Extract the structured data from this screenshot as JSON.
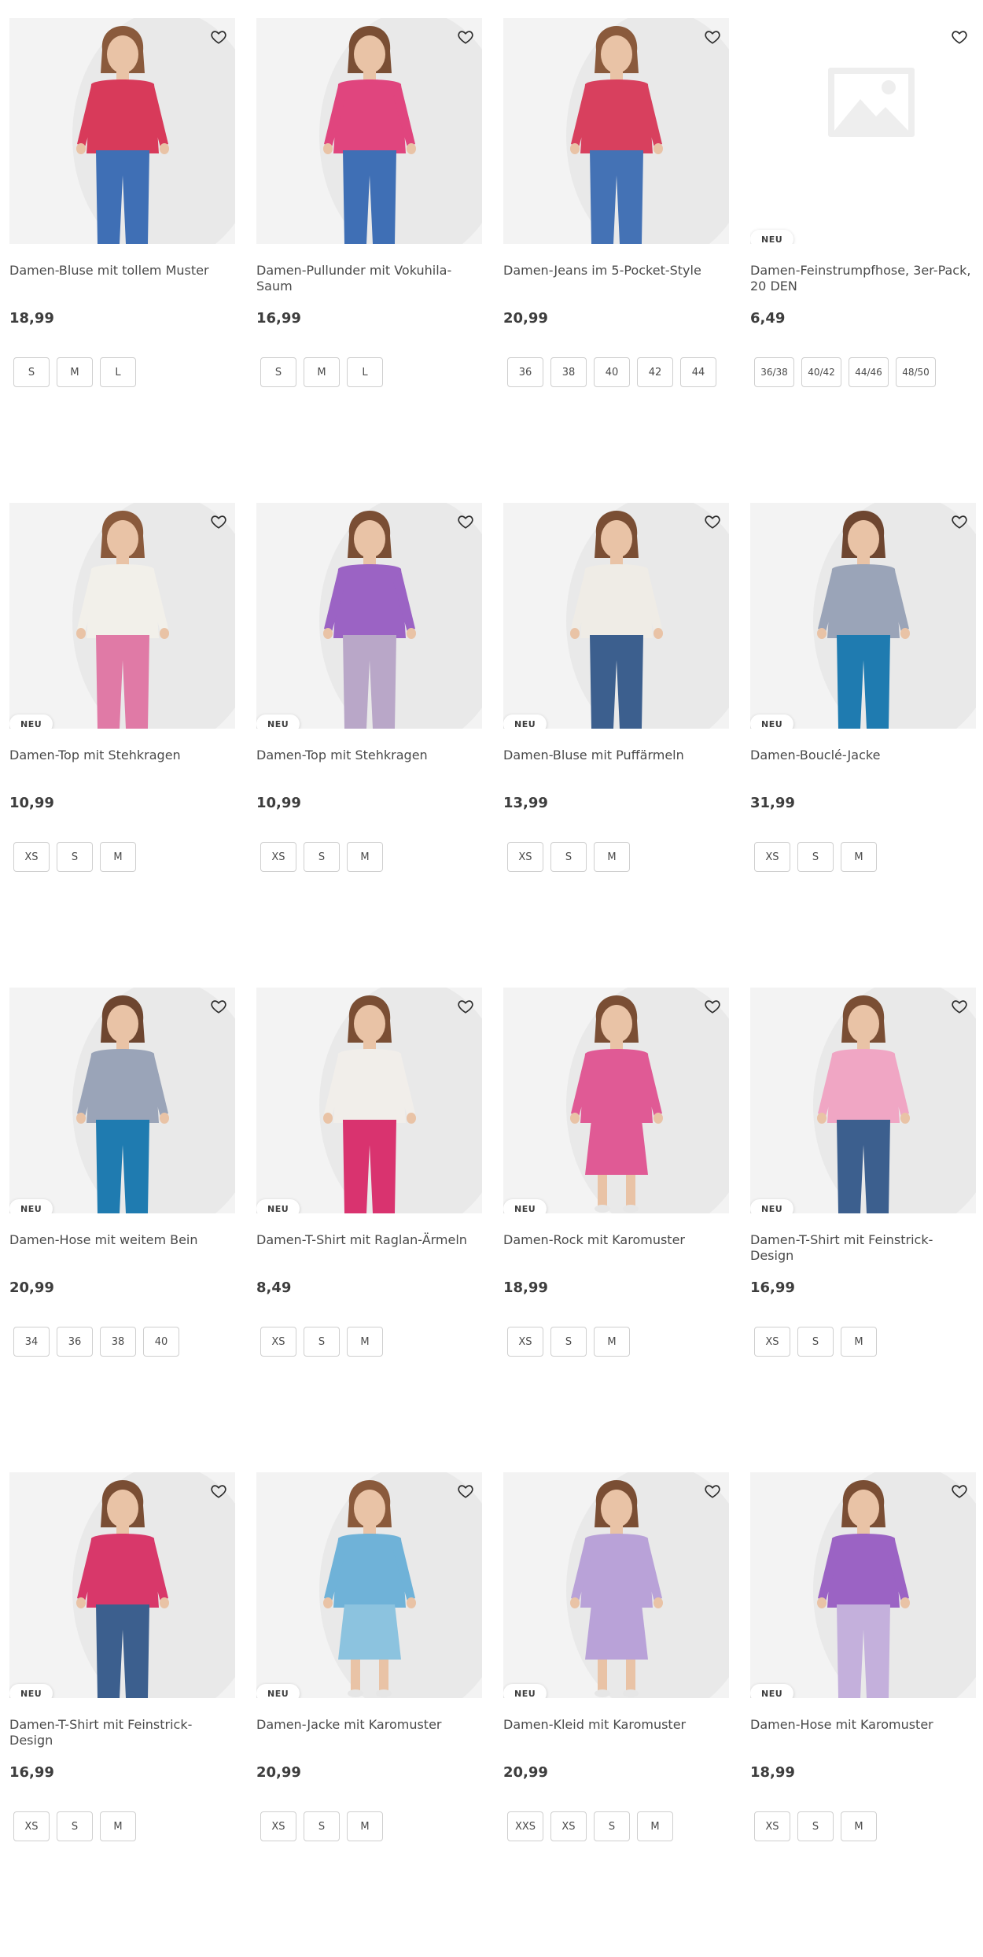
{
  "colors": {
    "text": "#3d3d3d",
    "border": "#cfcfcf",
    "image_bg": "#f3f3f3"
  },
  "badge_label": "NEU",
  "products": [
    {
      "name": "Damen-Bluse mit tollem Muster",
      "price": "18,99",
      "sizes": [
        "S",
        "M",
        "L"
      ],
      "badge": false,
      "image": "model-red-patterned-blouse-jeans",
      "top": "#d83a5a",
      "bottom": "#3f6fb5",
      "bottomType": "pants",
      "hair": "#8a5a3c"
    },
    {
      "name": "Damen-Pullunder mit Vokuhila-Saum",
      "price": "16,99",
      "sizes": [
        "S",
        "M",
        "L"
      ],
      "badge": false,
      "image": "model-pink-sleeveless-top",
      "top": "#e0457e",
      "bottom": "#3f6fb5",
      "bottomType": "pants",
      "hair": "#7a4e34"
    },
    {
      "name": "Damen-Jeans im 5-Pocket-Style",
      "price": "20,99",
      "sizes": [
        "36",
        "38",
        "40",
        "42",
        "44"
      ],
      "badge": false,
      "image": "model-jeans-full-body",
      "top": "#d8405e",
      "bottom": "#4472b5",
      "bottomType": "pants",
      "hair": "#8a5a3c"
    },
    {
      "name": "Damen-Feinstrumpfhose, 3er-Pack, 20 DEN",
      "price": "6,49",
      "sizes": [
        "36/38",
        "40/42",
        "44/46",
        "48/50"
      ],
      "badge": true,
      "image": "placeholder-image-icon",
      "placeholder": true
    },
    {
      "name": "Damen-Top mit Stehkragen",
      "price": "10,99",
      "sizes": [
        "XS",
        "S",
        "M"
      ],
      "badge": true,
      "image": "model-white-top-pink-check-pants",
      "top": "#f2f0ea",
      "bottom": "#e07aa6",
      "bottomType": "pants",
      "hair": "#8a5a3c"
    },
    {
      "name": "Damen-Top mit Stehkragen",
      "price": "10,99",
      "sizes": [
        "XS",
        "S",
        "M"
      ],
      "badge": true,
      "image": "model-purple-top-check-pants",
      "top": "#9b63c4",
      "bottom": "#b9a7c8",
      "bottomType": "pants",
      "hair": "#7a4e34"
    },
    {
      "name": "Damen-Bluse mit Puffärmeln",
      "price": "13,99",
      "sizes": [
        "XS",
        "S",
        "M"
      ],
      "badge": true,
      "image": "model-white-blouse-jeans",
      "top": "#efece6",
      "bottom": "#3c5f8e",
      "bottomType": "pants",
      "hair": "#7a4e34"
    },
    {
      "name": "Damen-Bouclé-Jacke",
      "price": "31,99",
      "sizes": [
        "XS",
        "S",
        "M"
      ],
      "badge": true,
      "image": "model-boucle-jacket-blue-pants",
      "top": "#9aa4b8",
      "bottom": "#1f7bb0",
      "bottomType": "pants",
      "hair": "#6e4630"
    },
    {
      "name": "Damen-Hose mit weitem Bein",
      "price": "20,99",
      "sizes": [
        "34",
        "36",
        "38",
        "40"
      ],
      "badge": true,
      "image": "model-wide-leg-blue-pants",
      "top": "#9aa4b8",
      "bottom": "#1f7bb0",
      "bottomType": "pants",
      "hair": "#6e4630"
    },
    {
      "name": "Damen-T-Shirt mit Raglan-Ärmeln",
      "price": "8,49",
      "sizes": [
        "XS",
        "S",
        "M"
      ],
      "badge": true,
      "image": "model-raglan-tshirt-pink-pants",
      "top": "#f1eeea",
      "bottom": "#d9336f",
      "bottomType": "pants",
      "hair": "#7a4e34"
    },
    {
      "name": "Damen-Rock mit Karomuster",
      "price": "18,99",
      "sizes": [
        "XS",
        "S",
        "M"
      ],
      "badge": true,
      "image": "model-pink-check-skirt-set",
      "top": "#e05a95",
      "bottom": "#e05a95",
      "bottomType": "skirt",
      "hair": "#7a4e34"
    },
    {
      "name": "Damen-T-Shirt mit Feinstrick-Design",
      "price": "16,99",
      "sizes": [
        "XS",
        "S",
        "M"
      ],
      "badge": true,
      "image": "model-pink-knit-tshirt",
      "top": "#f0a6c4",
      "bottom": "#3c5f8e",
      "bottomType": "pants",
      "hair": "#7a4e34"
    },
    {
      "name": "Damen-T-Shirt mit Feinstrick-Design",
      "price": "16,99",
      "sizes": [
        "XS",
        "S",
        "M"
      ],
      "badge": true,
      "image": "model-red-check-knit-tshirt",
      "top": "#d8386a",
      "bottom": "#3c5f8e",
      "bottomType": "pants",
      "hair": "#7a4e34"
    },
    {
      "name": "Damen-Jacke mit Karomuster",
      "price": "20,99",
      "sizes": [
        "XS",
        "S",
        "M"
      ],
      "badge": true,
      "image": "model-blue-check-jacket-skirt",
      "top": "#6fb2d8",
      "bottom": "#8cc3df",
      "bottomType": "skirt",
      "hair": "#8a5a3c"
    },
    {
      "name": "Damen-Kleid mit Karomuster",
      "price": "20,99",
      "sizes": [
        "XXS",
        "XS",
        "S",
        "M"
      ],
      "badge": true,
      "image": "model-lilac-check-dress",
      "top": "#b9a2d8",
      "bottom": "#b9a2d8",
      "bottomType": "skirt",
      "hair": "#7a4e34"
    },
    {
      "name": "Damen-Hose mit Karomuster",
      "price": "18,99",
      "sizes": [
        "XS",
        "S",
        "M"
      ],
      "badge": true,
      "image": "model-purple-top-lilac-check-pants",
      "top": "#9b63c4",
      "bottom": "#c4b0dc",
      "bottomType": "pants",
      "hair": "#7a4e34"
    }
  ]
}
